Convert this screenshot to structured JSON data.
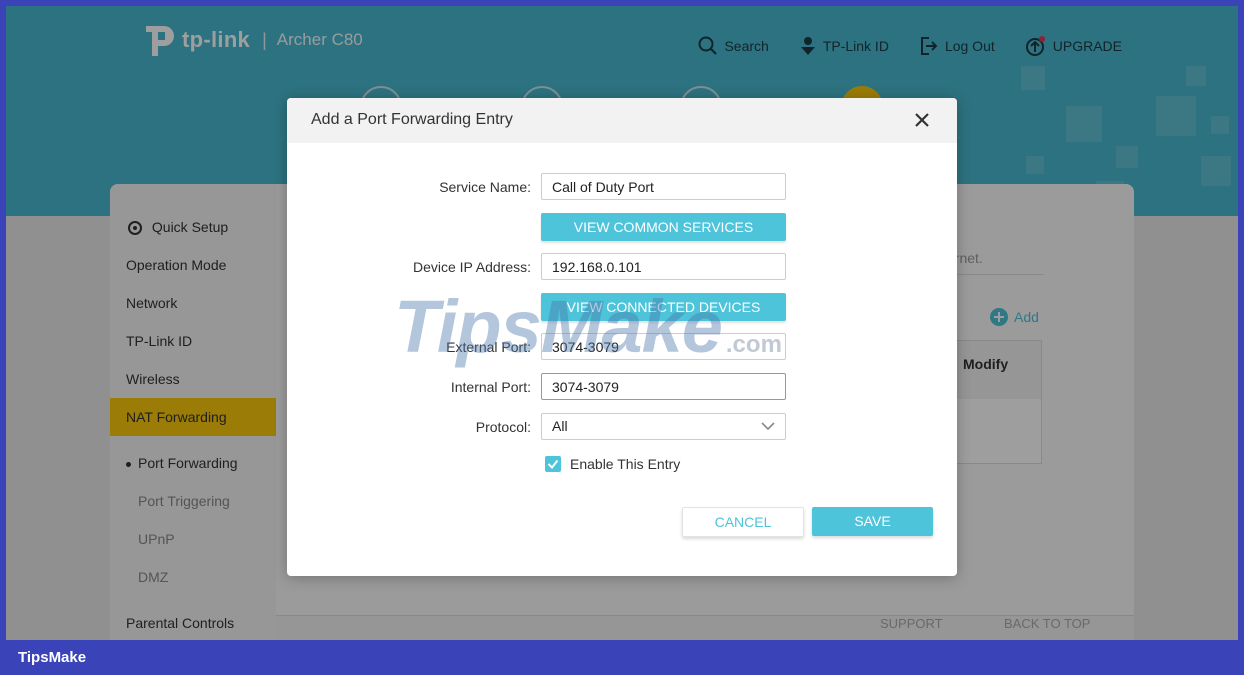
{
  "header": {
    "brand": "tp-link",
    "model": "Archer C80",
    "nav": [
      {
        "label": "Search",
        "icon": "search-icon"
      },
      {
        "label": "TP-Link ID",
        "icon": "user-icon"
      },
      {
        "label": "Log Out",
        "icon": "logout-icon"
      },
      {
        "label": "UPGRADE",
        "icon": "upgrade-icon"
      }
    ]
  },
  "sidebar": {
    "items": [
      {
        "label": "Quick Setup"
      },
      {
        "label": "Operation Mode"
      },
      {
        "label": "Network"
      },
      {
        "label": "TP-Link ID"
      },
      {
        "label": "Wireless"
      },
      {
        "label": "NAT Forwarding"
      },
      {
        "label": "Port Forwarding"
      },
      {
        "label": "Port Triggering"
      },
      {
        "label": "UPnP"
      },
      {
        "label": "DMZ"
      },
      {
        "label": "Parental Controls"
      }
    ]
  },
  "content": {
    "desc_tail": "ernet.",
    "add_label": "Add",
    "modify_header": "Modify"
  },
  "footer": {
    "support": "SUPPORT",
    "back_to_top": "BACK TO TOP"
  },
  "modal": {
    "title": "Add a Port Forwarding Entry",
    "service_name_label": "Service Name:",
    "service_name_value": "Call of Duty Port",
    "view_common_services": "VIEW COMMON SERVICES",
    "device_ip_label": "Device IP Address:",
    "device_ip_value": "192.168.0.101",
    "view_connected_devices": "VIEW CONNECTED DEVICES",
    "external_port_label": "External Port:",
    "external_port_value": "3074-3079",
    "internal_port_label": "Internal Port:",
    "internal_port_value": "3074-3079",
    "protocol_label": "Protocol:",
    "protocol_value": "All",
    "enable_label": "Enable This Entry",
    "enable_checked": true,
    "cancel": "CANCEL",
    "save": "SAVE"
  },
  "watermark": {
    "text": "TipsMake",
    "suffix": ".com"
  },
  "brand_bar": "TipsMake",
  "colors": {
    "header": "#4ab8cf",
    "accent": "#4dc4d9",
    "active_menu": "#f9c90a",
    "brand_bar": "#3a44b8"
  }
}
